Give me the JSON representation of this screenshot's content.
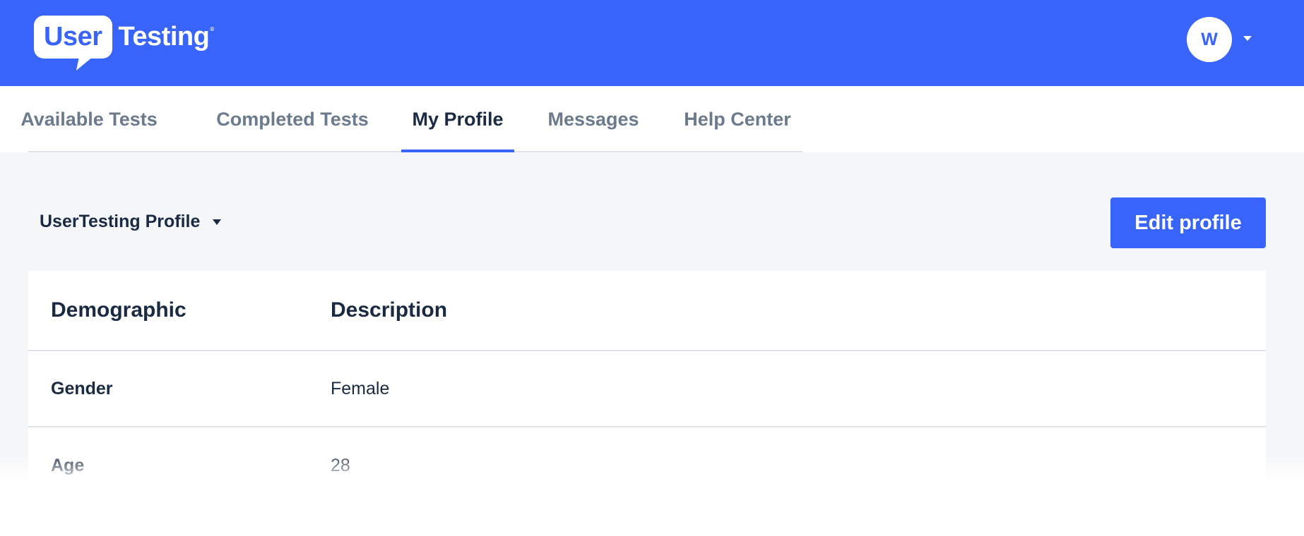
{
  "header": {
    "logo": {
      "bubble_text": "User",
      "wordmark": "Testing",
      "registered_mark": "®"
    },
    "avatar_initial": "W",
    "icons": {
      "avatar_menu": "caret-down-icon"
    }
  },
  "nav": {
    "tabs": [
      {
        "label": "Available Tests",
        "active": false
      },
      {
        "label": "Completed Tests",
        "active": false
      },
      {
        "label": "My Profile",
        "active": true
      },
      {
        "label": "Messages",
        "active": false
      },
      {
        "label": "Help Center",
        "active": false
      }
    ]
  },
  "profile": {
    "selector_label": "UserTesting Profile",
    "edit_button": "Edit profile"
  },
  "demographics_table": {
    "headers": [
      "Demographic",
      "Description"
    ],
    "rows": [
      {
        "demographic": "Gender",
        "description": "Female"
      },
      {
        "demographic": "Age",
        "description": "28"
      }
    ]
  },
  "colors": {
    "brand_blue": "#3864fa",
    "text_dark": "#1b2a43",
    "text_muted": "#6b7a8d",
    "page_bg": "#f5f6f8",
    "divider": "#dfe3e8"
  }
}
